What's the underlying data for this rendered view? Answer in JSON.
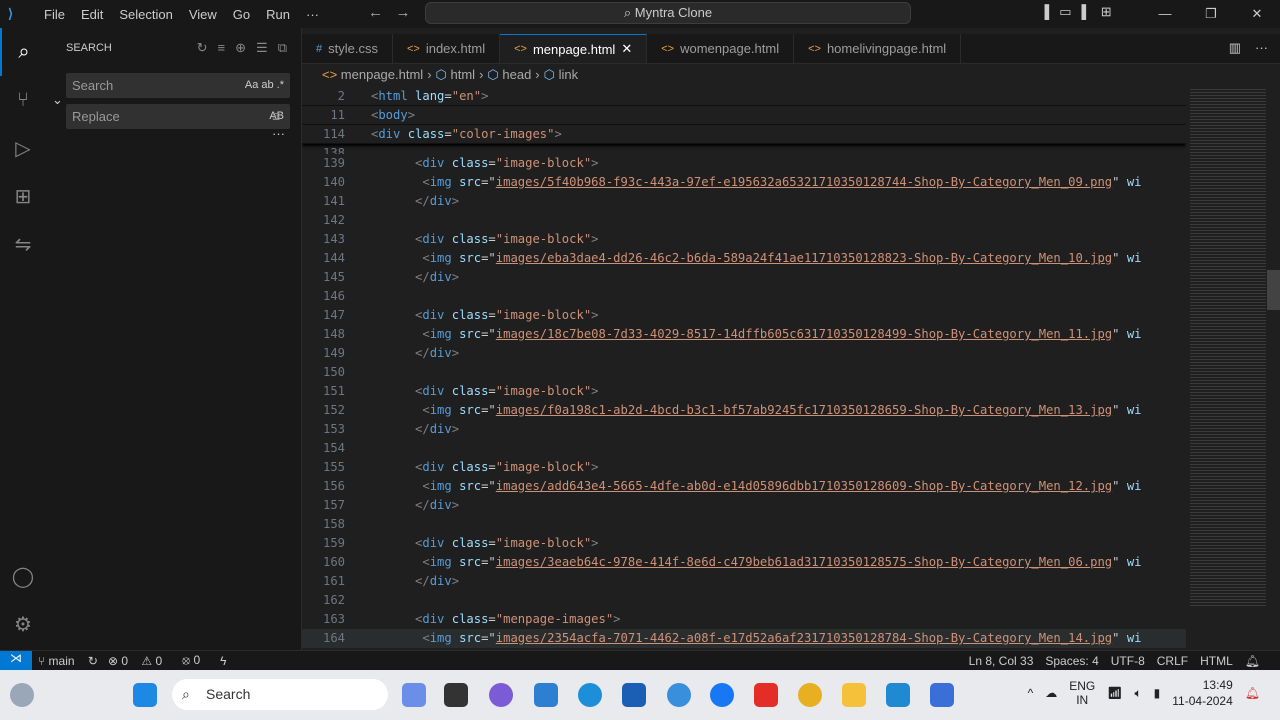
{
  "titlebar": {
    "menu": [
      "File",
      "Edit",
      "Selection",
      "View",
      "Go",
      "Run",
      "···"
    ],
    "search": "Myntra Clone"
  },
  "sidebar": {
    "title": "SEARCH",
    "search_placeholder": "Search",
    "search_opts": "Aa ab .*",
    "replace_placeholder": "Replace",
    "replace_opt": "AB"
  },
  "tabs": [
    {
      "label": "style.css",
      "icon": "#"
    },
    {
      "label": "index.html",
      "icon": "<>"
    },
    {
      "label": "menpage.html",
      "icon": "<>",
      "active": true
    },
    {
      "label": "womenpage.html",
      "icon": "<>"
    },
    {
      "label": "homelivingpage.html",
      "icon": "<>"
    }
  ],
  "breadcrumb": [
    "menpage.html",
    "html",
    "head",
    "link"
  ],
  "sticky": [
    {
      "n": "2",
      "tokens": [
        [
          "tag",
          "<"
        ],
        [
          "name",
          "html"
        ],
        [
          "txt",
          " "
        ],
        [
          "attr",
          "lang"
        ],
        [
          "txt",
          "="
        ],
        [
          "str",
          "\"en\""
        ],
        [
          "tag",
          ">"
        ]
      ]
    },
    {
      "n": "11",
      "tokens": [
        [
          "tag",
          "<"
        ],
        [
          "name",
          "body"
        ],
        [
          "tag",
          ">"
        ]
      ]
    },
    {
      "n": "114",
      "tokens": [
        [
          "tag",
          "<"
        ],
        [
          "name",
          "div"
        ],
        [
          "txt",
          " "
        ],
        [
          "attr",
          "class"
        ],
        [
          "txt",
          "="
        ],
        [
          "str",
          "\"color-images\""
        ],
        [
          "tag",
          ">"
        ]
      ]
    }
  ],
  "images": [
    {
      "open": "139",
      "img": "140",
      "close": "141",
      "blank": "142",
      "src": "images/5f40b968-f93c-443a-97ef-e195632a65321710350128744-Shop-By-Category_Men_09.png"
    },
    {
      "open": "143",
      "img": "144",
      "close": "145",
      "blank": "146",
      "src": "images/eba3dae4-dd26-46c2-b6da-589a24f41ae11710350128823-Shop-By-Category_Men_10.jpg"
    },
    {
      "open": "147",
      "img": "148",
      "close": "149",
      "blank": "150",
      "src": "images/18c7be08-7d33-4029-8517-14dffb605c631710350128499-Shop-By-Category_Men_11.jpg"
    },
    {
      "open": "151",
      "img": "152",
      "close": "153",
      "blank": "154",
      "src": "images/f0a198c1-ab2d-4bcd-b3c1-bf57ab9245fc1710350128659-Shop-By-Category_Men_13.jpg"
    },
    {
      "open": "155",
      "img": "156",
      "close": "157",
      "blank": "158",
      "src": "images/add643e4-5665-4dfe-ab0d-e14d05896dbb1710350128609-Shop-By-Category_Men_12.jpg"
    },
    {
      "open": "159",
      "img": "160",
      "close": "161",
      "blank": "162",
      "src": "images/3eaeb64c-978e-414f-8e6d-c479beb61ad31710350128575-Shop-By-Category_Men_06.png"
    }
  ],
  "block_class": "\"image-block\"",
  "last": {
    "open": "163",
    "open_class": "\"menpage-images\"",
    "img": "164",
    "src": "images/2354acfa-7071-4462-a08f-e17d52a6af231710350128784-Shop-By-Category_Men_14.jpg"
  },
  "status": {
    "branch": "main",
    "errors": "0",
    "warnings": "0",
    "ports": "0",
    "position": "Ln 8, Col 33",
    "spaces": "Spaces: 4",
    "encoding": "UTF-8",
    "eol": "CRLF",
    "language": "HTML"
  },
  "taskbar": {
    "search": "Search",
    "lang1": "ENG",
    "lang2": "IN",
    "time": "13:49",
    "date": "11-04-2024"
  }
}
